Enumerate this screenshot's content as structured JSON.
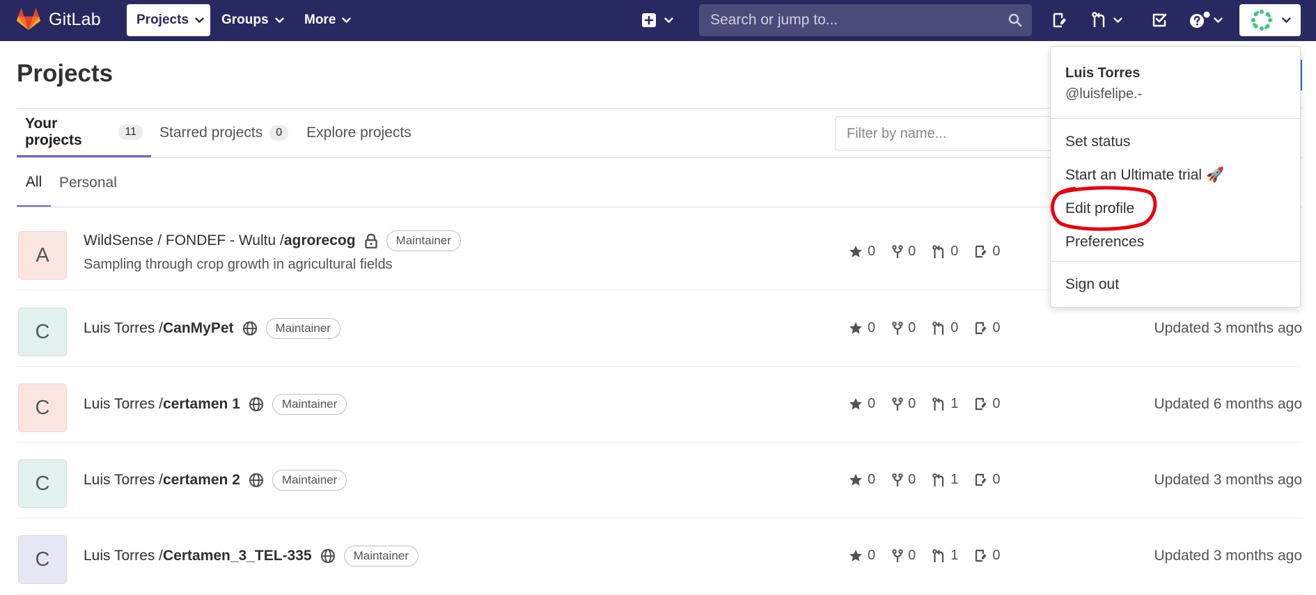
{
  "navbar": {
    "brand": "GitLab",
    "projects": "Projects",
    "groups": "Groups",
    "more": "More",
    "search_placeholder": "Search or jump to..."
  },
  "page": {
    "title": "Projects",
    "tabs": [
      {
        "label": "Your projects",
        "count": "11"
      },
      {
        "label": "Starred projects",
        "count": "0"
      },
      {
        "label": "Explore projects"
      }
    ],
    "filter_placeholder": "Filter by name...",
    "subtabs": [
      "All",
      "Personal"
    ]
  },
  "projects": [
    {
      "avatar_letter": "A",
      "avatar_bg": "#fbe5e1",
      "namespace": "WildSense / FONDEF - Wultu / ",
      "name": "agrorecog",
      "visibility": "lock-icon",
      "role": "Maintainer",
      "description": "Sampling through crop growth in agricultural fields",
      "stars": "0",
      "forks": "0",
      "merge_requests": "0",
      "issues": "0",
      "updated": ""
    },
    {
      "avatar_letter": "C",
      "avatar_bg": "#e1f1ee",
      "namespace": "Luis Torres / ",
      "name": "CanMyPet",
      "visibility": "globe-icon",
      "role": "Maintainer",
      "stars": "0",
      "forks": "0",
      "merge_requests": "0",
      "issues": "0",
      "updated": "Updated 3 months ago"
    },
    {
      "avatar_letter": "C",
      "avatar_bg": "#fbe5e1",
      "namespace": "Luis Torres / ",
      "name": "certamen 1",
      "visibility": "globe-icon",
      "role": "Maintainer",
      "stars": "0",
      "forks": "0",
      "merge_requests": "1",
      "issues": "0",
      "updated": "Updated 6 months ago"
    },
    {
      "avatar_letter": "C",
      "avatar_bg": "#e1f1ee",
      "namespace": "Luis Torres / ",
      "name": "certamen 2",
      "visibility": "globe-icon",
      "role": "Maintainer",
      "stars": "0",
      "forks": "0",
      "merge_requests": "1",
      "issues": "0",
      "updated": "Updated 3 months ago"
    },
    {
      "avatar_letter": "C",
      "avatar_bg": "#e6e6f4",
      "namespace": "Luis Torres / ",
      "name": "Certamen_3_TEL-335",
      "visibility": "globe-icon",
      "role": "Maintainer",
      "stars": "0",
      "forks": "0",
      "merge_requests": "1",
      "issues": "0",
      "updated": "Updated 3 months ago"
    }
  ],
  "user_menu": {
    "name": "Luis Torres",
    "handle": "@luisfelipe.-",
    "items": [
      "Set status",
      "Start an Ultimate trial",
      "Edit profile",
      "Preferences",
      "Sign out"
    ],
    "trial_emoji": "🚀",
    "highlighted_item": "Edit profile"
  },
  "colors": {
    "navbar": "#292961",
    "accent": "#6666c4",
    "highlight_ring": "#e8000d"
  }
}
